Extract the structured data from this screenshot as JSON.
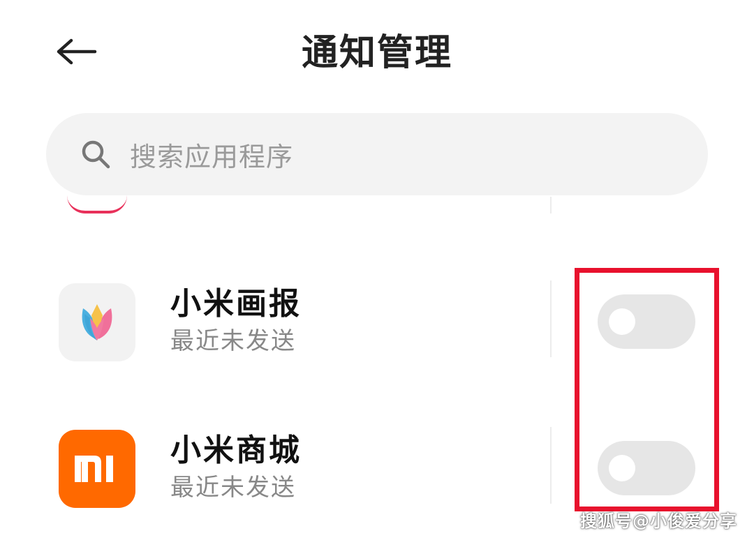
{
  "header": {
    "title": "通知管理",
    "back_icon": "arrow-left-icon"
  },
  "search": {
    "placeholder": "搜索应用程序",
    "icon": "search-icon"
  },
  "apps": [
    {
      "name": "小米画报",
      "status": "最近未发送",
      "icon": "tulip-icon",
      "notifications_enabled": false
    },
    {
      "name": "小米商城",
      "status": "最近未发送",
      "icon": "mi-logo-icon",
      "icon_color": "#ff6900",
      "notifications_enabled": false
    }
  ],
  "highlight_color": "#e8112d",
  "watermark": "搜狐号@小俊爱分享"
}
